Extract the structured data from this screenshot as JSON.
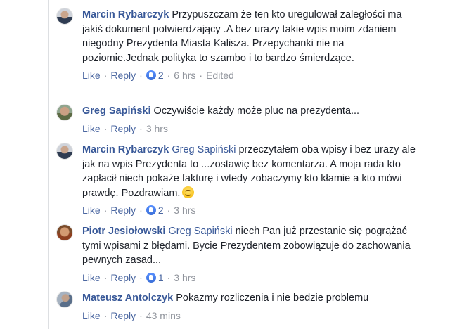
{
  "labels": {
    "like": "Like",
    "reply": "Reply"
  },
  "comments": [
    {
      "author": "Marcin Rybarczyk",
      "mention": "",
      "text": "Przypuszczam że ten kto uregulował zaległości ma jakiś dokument potwierdzający .A bez urazy takie wpis moim zdaniem niegodny Prezydenta Miasta Kalisza. Przepychanki nie na poziomie.Jednak polityka to szambo i to bardzo śmierdzące.",
      "likes": "2",
      "time": "6 hrs",
      "edited": "Edited"
    },
    {
      "author": "Greg Sapiński",
      "mention": "",
      "text": "Oczywiście każdy może pluc na prezydenta...",
      "likes": "",
      "time": "3 hrs",
      "edited": ""
    },
    {
      "author": "Marcin Rybarczyk",
      "mention": "Greg Sapiński",
      "text": "przeczytałem oba wpisy i bez urazy ale jak na wpis Prezydenta to ...zostawię bez komentarza. A moja rada kto zapłacił niech pokaże fakturę i wtedy zobaczymy kto kłamie a kto mówi prawdę. Pozdrawiam.",
      "likes": "2",
      "time": "3 hrs",
      "edited": ""
    },
    {
      "author": "Piotr Jesiołowski",
      "mention": "Greg Sapiński",
      "text": "niech Pan już przestanie się pogrążać tymi wpisami z błędami. Bycie Prezydentem zobowiązuje do zachowania pewnych zasad...",
      "likes": "1",
      "time": "3 hrs",
      "edited": ""
    },
    {
      "author": "Mateusz Antolczyk",
      "mention": "",
      "text": "Pokazmy rozliczenia i nie bedzie problemu",
      "likes": "",
      "time": "43 mins",
      "edited": ""
    }
  ],
  "colors": {
    "link": "#385898",
    "meta": "#90949c",
    "text": "#1d2129"
  }
}
